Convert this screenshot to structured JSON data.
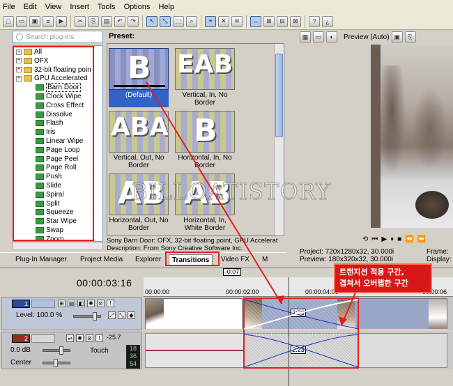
{
  "menu": [
    "File",
    "Edit",
    "View",
    "Insert",
    "Tools",
    "Options",
    "Help"
  ],
  "plugins": {
    "search_placeholder": "Search plug-ins",
    "tree": [
      {
        "label": "All",
        "kind": "folder",
        "expand": "+"
      },
      {
        "label": "OFX",
        "kind": "folder",
        "expand": "+"
      },
      {
        "label": "32-bit floating poin",
        "kind": "folder",
        "expand": "+"
      },
      {
        "label": "GPU Accelerated",
        "kind": "folder",
        "expand": "+"
      },
      {
        "label": "Barn Door",
        "kind": "fx",
        "selected": true
      },
      {
        "label": "Clock Wipe",
        "kind": "fx"
      },
      {
        "label": "Cross Effect",
        "kind": "fx"
      },
      {
        "label": "Dissolve",
        "kind": "fx"
      },
      {
        "label": "Flash",
        "kind": "fx"
      },
      {
        "label": "Iris",
        "kind": "fx"
      },
      {
        "label": "Linear Wipe",
        "kind": "fx"
      },
      {
        "label": "Page Loop",
        "kind": "fx"
      },
      {
        "label": "Page Peel",
        "kind": "fx"
      },
      {
        "label": "Page Roll",
        "kind": "fx"
      },
      {
        "label": "Push",
        "kind": "fx"
      },
      {
        "label": "Slide",
        "kind": "fx"
      },
      {
        "label": "Spiral",
        "kind": "fx"
      },
      {
        "label": "Split",
        "kind": "fx"
      },
      {
        "label": "Squeeze",
        "kind": "fx"
      },
      {
        "label": "Star Wipe",
        "kind": "fx"
      },
      {
        "label": "Swap",
        "kind": "fx"
      },
      {
        "label": "Zoom",
        "kind": "fx"
      }
    ]
  },
  "presets": {
    "label": "Preset:",
    "items": [
      {
        "caption": "(Default)",
        "letters": "B",
        "selected": true
      },
      {
        "caption": "Vertical, In, No Border",
        "letters": "EAB"
      },
      {
        "caption": "Vertical, Out, No Border",
        "letters": "ABA"
      },
      {
        "caption": "Horizontal, In, No Border",
        "letters": "B"
      },
      {
        "caption": "Horizontal, Out, No Border",
        "letters": "AB"
      },
      {
        "caption": "Horizontal, In, White Border",
        "letters": "AB"
      }
    ],
    "desc_line1": "Sony Barn Door: OFX, 32-bit floating point, GPU Accelerat",
    "desc_line2": "Description: From Sony Creative Software Inc."
  },
  "tabs": [
    {
      "label": "Plug-In Manager"
    },
    {
      "label": "Project Media"
    },
    {
      "label": "Explorer"
    },
    {
      "label": "Transitions",
      "active": true
    },
    {
      "label": "Video FX"
    },
    {
      "label": "M"
    }
  ],
  "preview": {
    "mode": "Preview (Auto)",
    "project_label": "Project:",
    "project_value": "720x1280x32, 30.000i",
    "preview_label": "Preview:",
    "preview_value": "180x320x32, 30.000i",
    "frame_label": "Frame:",
    "display_label": "Display:"
  },
  "timeline": {
    "timecode": "00:00:03:16",
    "cursor": "-0:07",
    "ruler": [
      "00:00:00",
      "00:00:02:00",
      "00:00:04:00",
      "00:00:06"
    ],
    "transition_time": "2:23",
    "audio_time": "2:23",
    "callout_line1": "트랜지션 적용 구간,",
    "callout_line2": "겹쳐서 오버랩한 구간"
  },
  "track1": {
    "number": "1",
    "level": "Level: 100.0 %"
  },
  "track2": {
    "number": "2",
    "db": "0.0 dB",
    "pan": "Center",
    "touch": "Touch",
    "meter_top": "-25.7",
    "meter_vals": [
      "18",
      "36",
      "54"
    ]
  },
  "watermark": "BILLOATISTORY"
}
